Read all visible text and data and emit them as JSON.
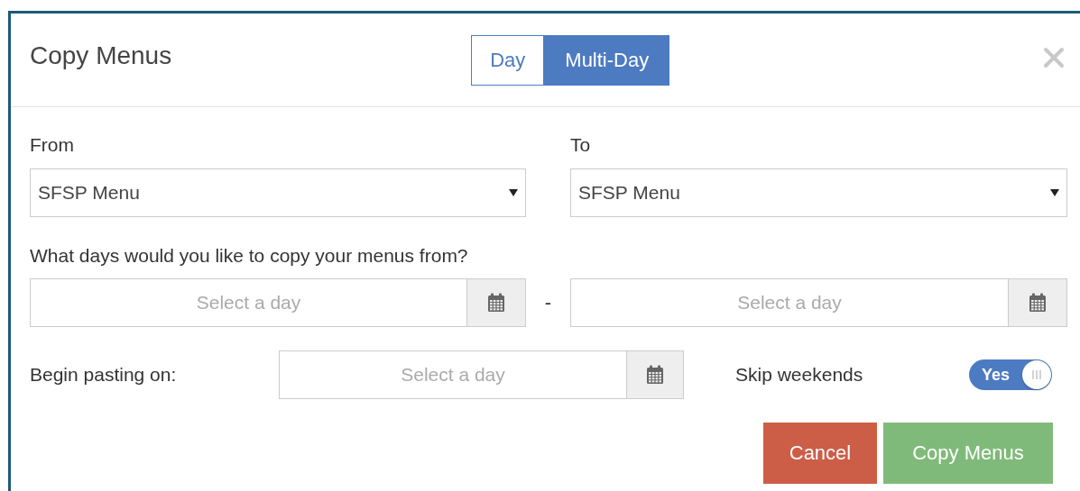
{
  "dialog": {
    "title": "Copy Menus",
    "mode_tabs": [
      {
        "label": "Day",
        "selected": false
      },
      {
        "label": "Multi-Day",
        "selected": true
      }
    ],
    "from": {
      "label": "From",
      "value": "SFSP Menu"
    },
    "to": {
      "label": "To",
      "value": "SFSP Menu"
    },
    "date_range": {
      "label": "What days would you like to copy your menus from?",
      "start": {
        "placeholder": "Select a day"
      },
      "separator": "-",
      "end": {
        "placeholder": "Select a day"
      }
    },
    "begin_pasting": {
      "label": "Begin pasting on:",
      "placeholder": "Select a day"
    },
    "skip_weekends": {
      "label": "Skip weekends",
      "on": true,
      "state_text": "Yes"
    },
    "buttons": [
      {
        "label": "Cancel",
        "kind": "cancel"
      },
      {
        "label": "Copy Menus",
        "kind": "confirm"
      }
    ]
  }
}
